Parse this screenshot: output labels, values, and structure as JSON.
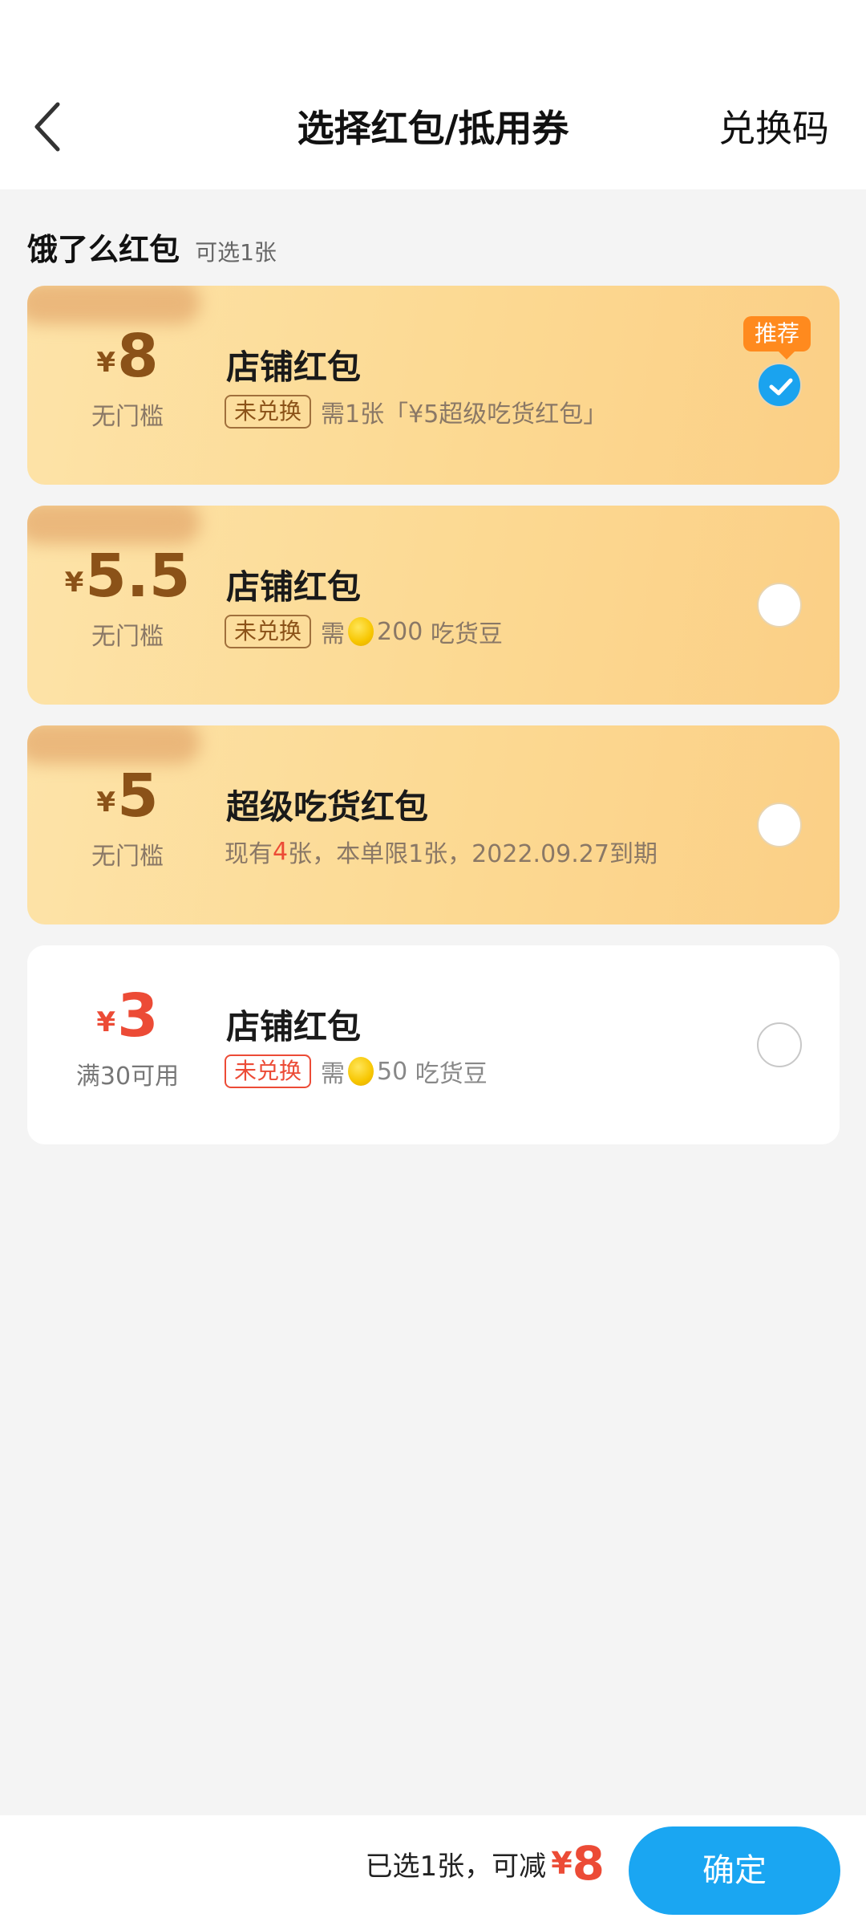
{
  "header": {
    "title": "选择红包/抵用券",
    "redeem": "兑换码"
  },
  "section": {
    "title": "饿了么红包",
    "note": "可选1张"
  },
  "cards": [
    {
      "yen": "¥",
      "amount": "8",
      "condition": "无门槛",
      "title": "店铺红包",
      "tag": "未兑换",
      "desc": "需1张「¥5超级吃货红包」",
      "recommended": "推荐",
      "selected": true
    },
    {
      "yen": "¥",
      "amount": "5.5",
      "condition": "无门槛",
      "title": "店铺红包",
      "tag": "未兑换",
      "desc_prefix": "需",
      "beans": "200",
      "desc_suffix": "吃货豆",
      "selected": false
    },
    {
      "yen": "¥",
      "amount": "5",
      "condition": "无门槛",
      "title": "超级吃货红包",
      "desc_a": "现有",
      "count": "4",
      "desc_b": "张，本单限1张，2022.09.27到期",
      "selected": false
    },
    {
      "yen": "¥",
      "amount": "3",
      "condition": "满30可用",
      "title": "店铺红包",
      "tag": "未兑换",
      "desc_prefix": "需",
      "beans": "50",
      "desc_suffix": "吃货豆",
      "selected": false
    }
  ],
  "footer": {
    "summary": "已选1张，可减",
    "yen": "¥",
    "amount": "8",
    "confirm": "确定"
  },
  "colors": {
    "accent_blue": "#1aa6f2",
    "price_red": "#ec4b36",
    "gold_card": "#fcd992",
    "badge_orange": "#ff8a1e"
  }
}
